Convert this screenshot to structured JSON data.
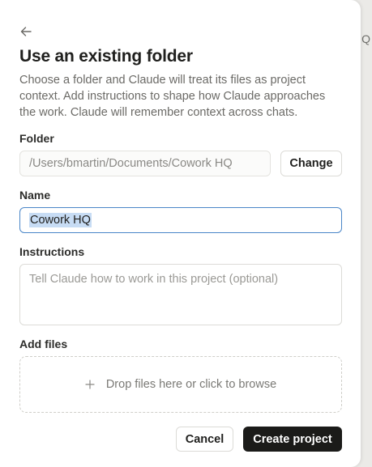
{
  "background": {
    "glyph": "Q"
  },
  "dialog": {
    "title": "Use an existing folder",
    "description": "Choose a folder and Claude will treat its files as project context. Add instructions to shape how Claude approaches the work. Claude will remember context across chats.",
    "back_icon": "arrow-left-icon",
    "folder": {
      "label": "Folder",
      "path": "/Users/bmartin/Documents/Cowork HQ",
      "change_label": "Change"
    },
    "name": {
      "label": "Name",
      "value": "Cowork HQ"
    },
    "instructions": {
      "label": "Instructions",
      "placeholder": "Tell Claude how to work in this project (optional)"
    },
    "files": {
      "label": "Add files",
      "dropzone_text": "Drop files here or click to browse",
      "icon": "plus-icon"
    },
    "actions": {
      "cancel_label": "Cancel",
      "create_label": "Create project"
    }
  },
  "colors": {
    "focus_border": "#4a86c8",
    "selection": "#c7dcf4",
    "primary_button": "#1b1b19"
  }
}
